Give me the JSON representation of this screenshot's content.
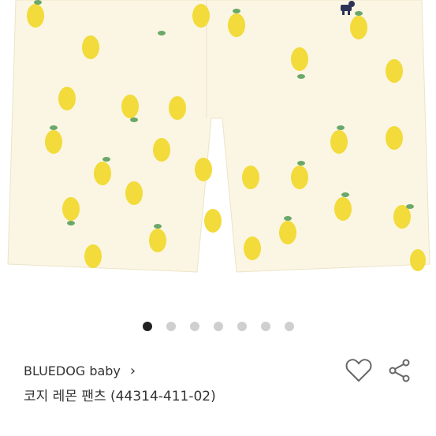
{
  "product": {
    "brand": "BLUEDOG baby",
    "brand_chevron": "›",
    "title": "코지 레몬 팬츠 (44314-411-02)"
  },
  "gallery": {
    "total_images": 7,
    "active_index": 0,
    "image_label": "lemon print shorts"
  },
  "actions": {
    "like_icon": "heart-icon",
    "share_icon": "share-icon"
  }
}
